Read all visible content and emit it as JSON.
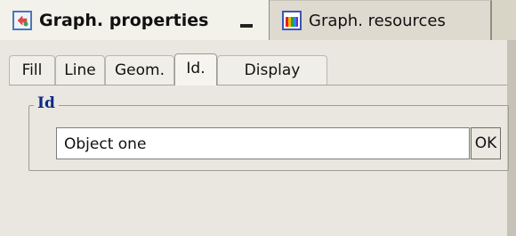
{
  "window_tabs": [
    {
      "label": "Graph. properties",
      "icon": "graph-properties-icon",
      "active": true
    },
    {
      "label": "Graph. resources",
      "icon": "graph-resources-icon",
      "active": false
    }
  ],
  "sub_tabs": [
    {
      "label": "Fill"
    },
    {
      "label": "Line"
    },
    {
      "label": "Geom."
    },
    {
      "label": "Id.",
      "selected": true
    },
    {
      "label": "Display"
    }
  ],
  "id_group": {
    "title": "Id",
    "value": "Object one",
    "ok_label": "OK"
  },
  "colors": {
    "group_title": "#0f2a86",
    "panel_bg": "#e9e7df"
  }
}
